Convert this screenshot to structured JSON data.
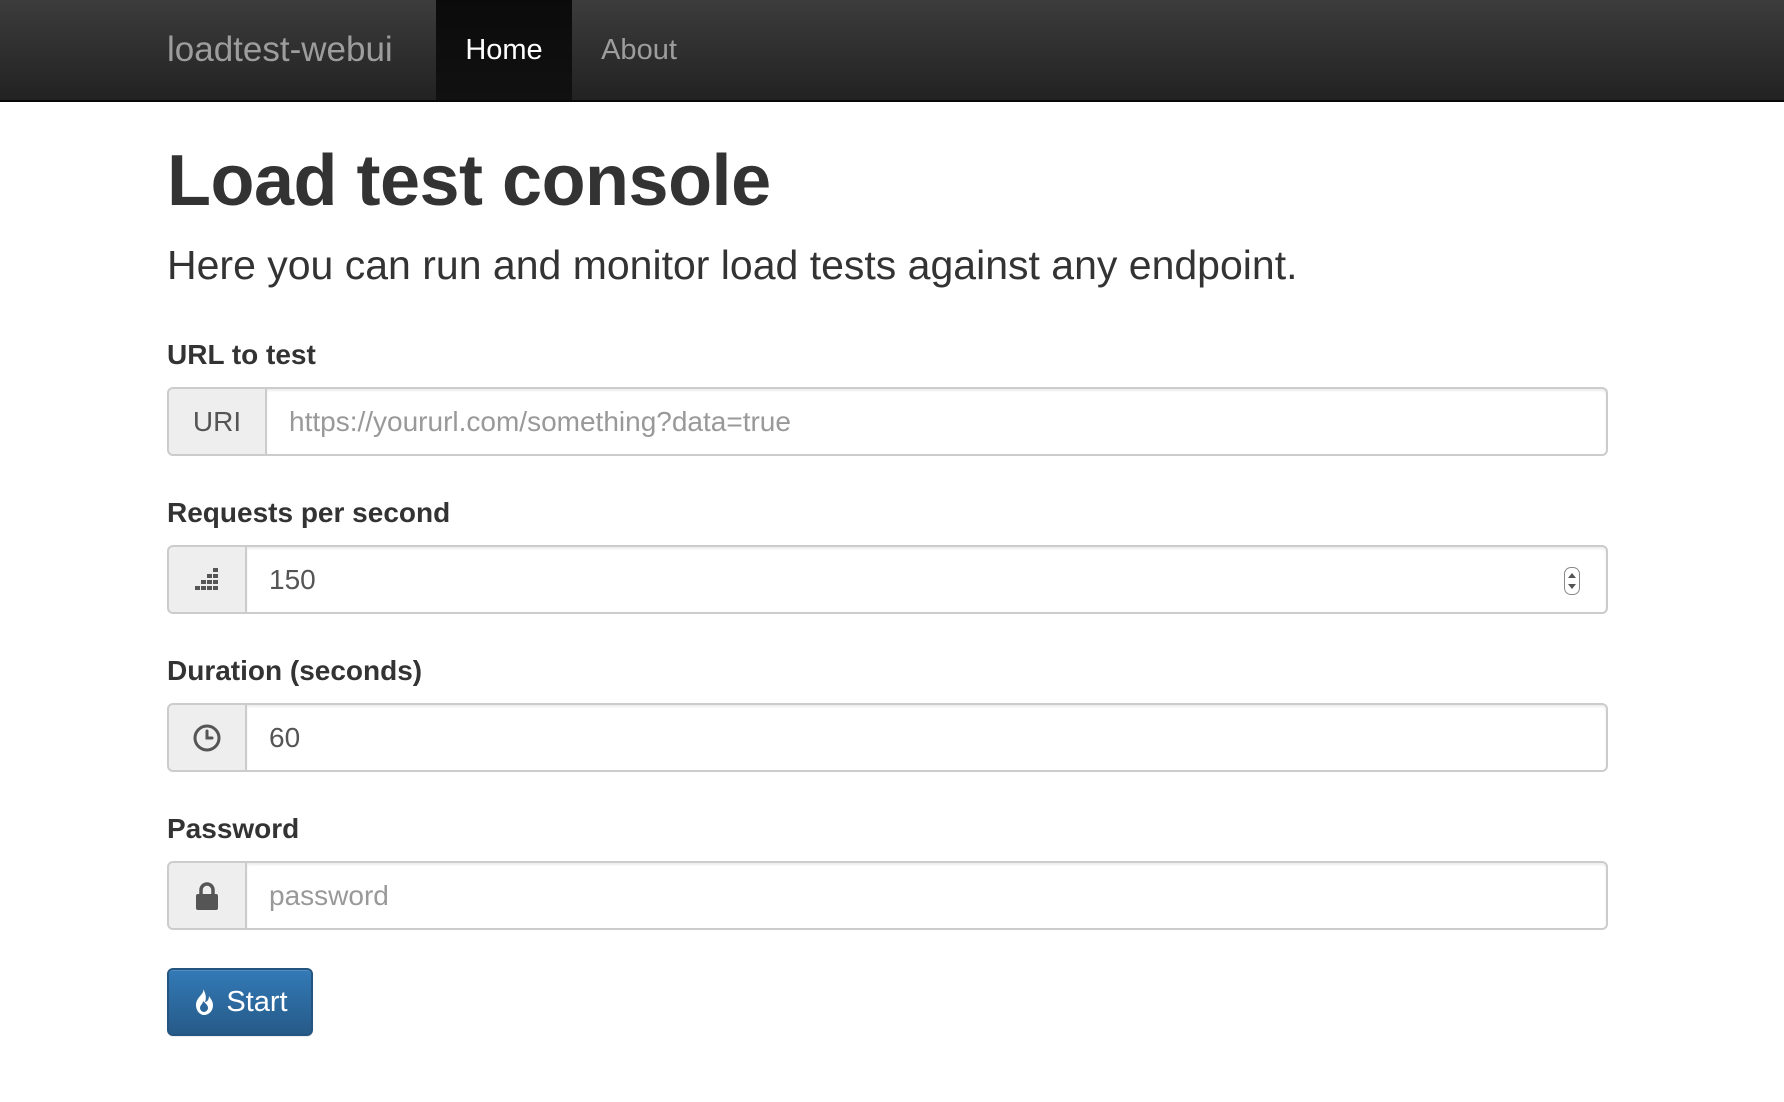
{
  "navbar": {
    "brand": "loadtest-webui",
    "items": [
      {
        "label": "Home",
        "active": true
      },
      {
        "label": "About",
        "active": false
      }
    ]
  },
  "page": {
    "title": "Load test console",
    "lead": "Here you can run and monitor load tests against any endpoint."
  },
  "form": {
    "url": {
      "label": "URL to test",
      "addon": "URI",
      "placeholder": "https://yoururl.com/something?data=true",
      "value": ""
    },
    "rps": {
      "label": "Requests per second",
      "addon_icon": "signal-bars-icon",
      "value": "150"
    },
    "duration": {
      "label": "Duration (seconds)",
      "addon_icon": "clock-icon",
      "value": "60"
    },
    "password": {
      "label": "Password",
      "addon_icon": "lock-icon",
      "placeholder": "password",
      "value": ""
    },
    "submit": {
      "label": "Start",
      "icon": "fire-icon"
    }
  },
  "colors": {
    "navbar_bg": "#222222",
    "nav_active_bg": "#0b0b0b",
    "primary": "#337ab7",
    "addon_bg": "#eeeeee",
    "border": "#cccccc"
  }
}
